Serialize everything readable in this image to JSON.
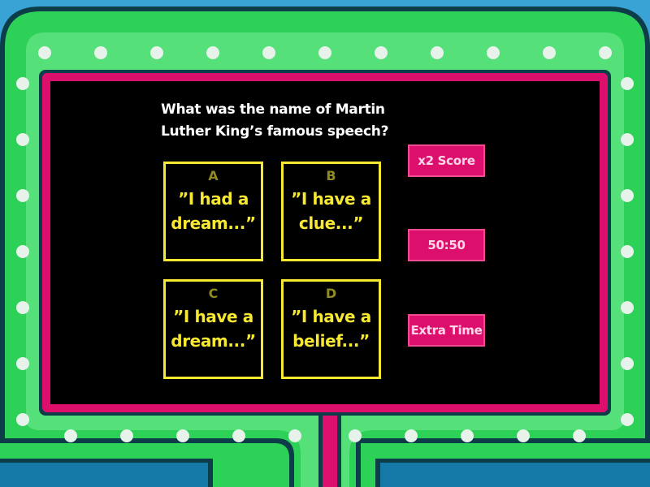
{
  "question": {
    "text": "What was the name of Martin Luther King’s famous speech?"
  },
  "answers": [
    {
      "letter": "A",
      "text": "”I had a dream...”"
    },
    {
      "letter": "B",
      "text": "”I have a clue...”"
    },
    {
      "letter": "C",
      "text": "”I have a dream...”"
    },
    {
      "letter": "D",
      "text": "”I have a belief...”"
    }
  ],
  "powerups": {
    "double_score": "x2 Score",
    "fifty_fifty": "50:50",
    "extra_time": "Extra Time"
  },
  "colors": {
    "sky": "#38a3d4",
    "frame_green": "#2ed158",
    "frame_outline": "#0e3d4a",
    "panel_magenta": "#dc0f6c",
    "screen": "#000000",
    "answer_yellow": "#f7e832",
    "bulb": "#e6f2ea"
  }
}
